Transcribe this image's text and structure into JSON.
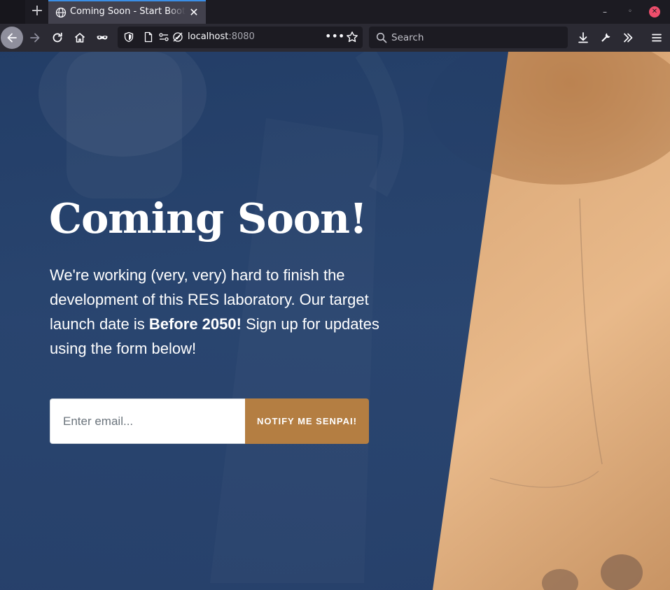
{
  "browser": {
    "tab_title": "Coming Soon - Start Bootstrap Theme",
    "url_host": "localhost",
    "url_port": ":8080",
    "search_placeholder": "Search",
    "icons": [
      "plus-icon",
      "globe-icon",
      "close-icon",
      "minimize-icon",
      "restore-icon",
      "window-close-icon",
      "back-arrow-icon",
      "forward-arrow-icon",
      "reload-icon",
      "home-icon",
      "mask-icon",
      "shield-icon",
      "page-icon",
      "permissions-icon",
      "tracking-icon",
      "more-dots-icon",
      "star-icon",
      "search-icon",
      "download-icon",
      "wrench-icon",
      "chevrons-right-icon",
      "hamburger-menu-icon"
    ]
  },
  "page": {
    "headline": "Coming Soon!",
    "lead_part1": "We're working (very, very) hard to finish the development of this RES laboratory. Our target launch date is ",
    "lead_bold": "Before 2050!",
    "lead_part2": " Sign up for updates using the form below!",
    "email_placeholder": "Enter email...",
    "notify_button": "NOTIFY ME SENPAI!"
  },
  "colors": {
    "overlay_blue": "#1f3d6e",
    "button_gold": "#b47e42",
    "tab_accent": "#3a8ee6"
  }
}
